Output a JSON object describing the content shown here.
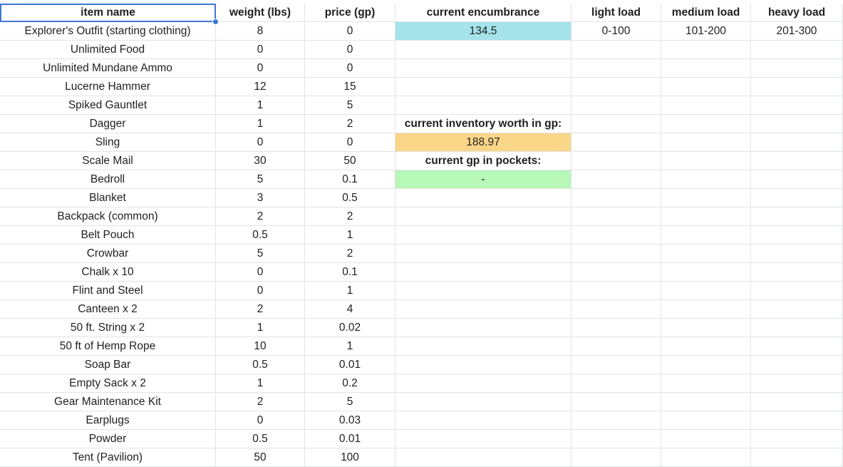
{
  "sheet": {
    "headers": [
      "item name",
      "weight (lbs)",
      "price (gp)",
      "current encumbrance",
      "light load",
      "medium load",
      "heavy load"
    ],
    "rows": [
      [
        "Explorer's Outfit (starting clothing)",
        "8",
        "0",
        "134.5",
        "0-100",
        "101-200",
        "201-300"
      ],
      [
        "Unlimited Food",
        "0",
        "0",
        "",
        "",
        "",
        ""
      ],
      [
        "Unlimited Mundane Ammo",
        "0",
        "0",
        "",
        "",
        "",
        ""
      ],
      [
        "Lucerne Hammer",
        "12",
        "15",
        "",
        "",
        "",
        ""
      ],
      [
        "Spiked Gauntlet",
        "1",
        "5",
        "",
        "",
        "",
        ""
      ],
      [
        "Dagger",
        "1",
        "2",
        "current inventory worth in gp:",
        "",
        "",
        ""
      ],
      [
        "Sling",
        "0",
        "0",
        "188.97",
        "",
        "",
        ""
      ],
      [
        "Scale Mail",
        "30",
        "50",
        "current gp in pockets:",
        "",
        "",
        ""
      ],
      [
        "Bedroll",
        "5",
        "0.1",
        "-",
        "",
        "",
        ""
      ],
      [
        "Blanket",
        "3",
        "0.5",
        "",
        "",
        "",
        ""
      ],
      [
        "Backpack (common)",
        "2",
        "2",
        "",
        "",
        "",
        ""
      ],
      [
        "Belt Pouch",
        "0.5",
        "1",
        "",
        "",
        "",
        ""
      ],
      [
        "Crowbar",
        "5",
        "2",
        "",
        "",
        "",
        ""
      ],
      [
        "Chalk x 10",
        "0",
        "0.1",
        "",
        "",
        "",
        ""
      ],
      [
        "Flint and Steel",
        "0",
        "1",
        "",
        "",
        "",
        ""
      ],
      [
        "Canteen x 2",
        "2",
        "4",
        "",
        "",
        "",
        ""
      ],
      [
        "50 ft. String x 2",
        "1",
        "0.02",
        "",
        "",
        "",
        ""
      ],
      [
        "50 ft of Hemp Rope",
        "10",
        "1",
        "",
        "",
        "",
        ""
      ],
      [
        "Soap Bar",
        "0.5",
        "0.01",
        "",
        "",
        "",
        ""
      ],
      [
        "Empty Sack x 2",
        "1",
        "0.2",
        "",
        "",
        "",
        ""
      ],
      [
        "Gear Maintenance Kit",
        "2",
        "5",
        "",
        "",
        "",
        ""
      ],
      [
        "Earplugs",
        "0",
        "0.03",
        "",
        "",
        "",
        ""
      ],
      [
        "Powder",
        "0.5",
        "0.01",
        "",
        "",
        "",
        ""
      ],
      [
        "Tent (Pavilion)",
        "50",
        "100",
        "",
        "",
        "",
        ""
      ]
    ]
  },
  "colors": {
    "encumbrance_fill": "#a4e3ea",
    "worth_fill": "#fad689",
    "pockets_fill": "#b7f7b7",
    "selection": "#3c78d8",
    "gridline": "#e2e3e3"
  }
}
